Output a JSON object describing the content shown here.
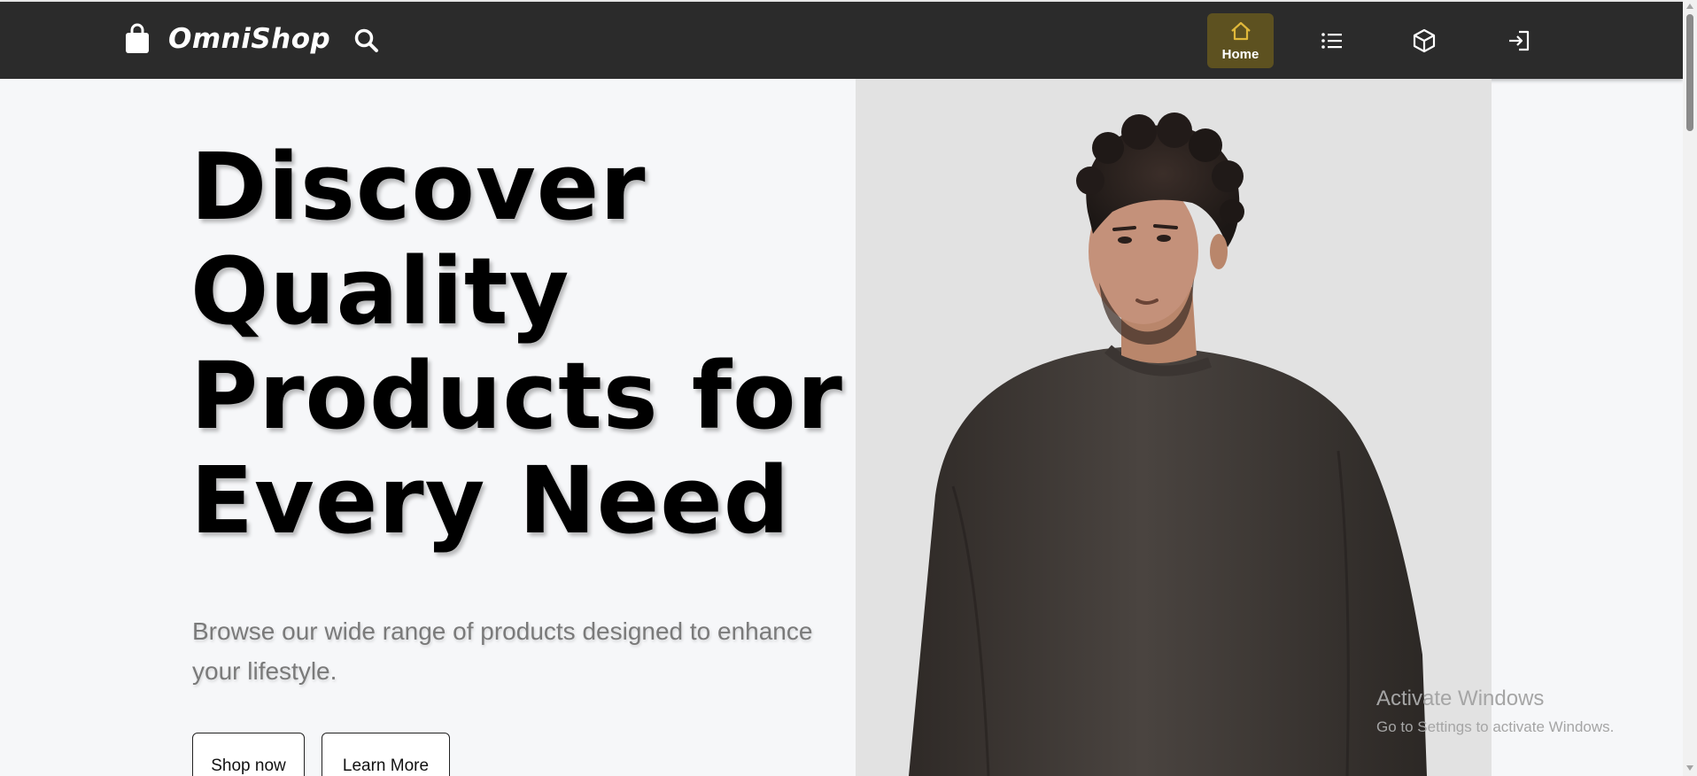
{
  "app": {
    "brand_name": "OmniShop",
    "brand_icon": "shopping-bag-icon"
  },
  "navbar": {
    "search_icon": "search-icon",
    "items": [
      {
        "label": "Home",
        "icon": "home-icon",
        "active": true
      },
      {
        "label": "",
        "icon": "list-icon",
        "active": false
      },
      {
        "label": "",
        "icon": "box-icon",
        "active": false
      },
      {
        "label": "",
        "icon": "sign-in-icon",
        "active": false
      }
    ]
  },
  "hero": {
    "title_lines": [
      "Discover",
      "Quality",
      "Products for",
      "Every Need"
    ],
    "subtitle_lines": [
      "Browse our wide range of products designed to enhance",
      "your lifestyle."
    ],
    "primary_button": "Shop now",
    "secondary_button": "Learn More",
    "image": "man-in-dark-sweater-photo"
  },
  "watermark": {
    "title": "Activate Windows",
    "subtitle": "Go to Settings to activate Windows."
  },
  "colors": {
    "navbar": "#2b2b2b",
    "active_nav": "#5d5120",
    "accent_icon": "#e0b83a",
    "page_bg": "#f6f7f9",
    "image_bg": "#e2e2e2"
  }
}
